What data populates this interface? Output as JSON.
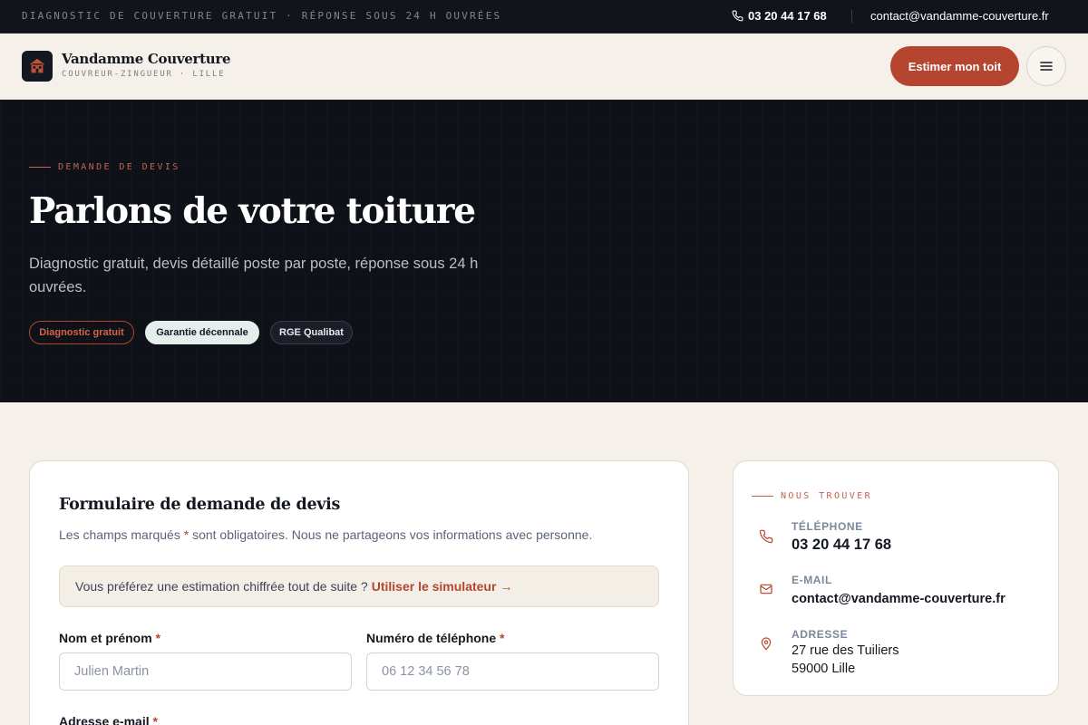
{
  "topbar": {
    "tagline": "DIAGNOSTIC DE COUVERTURE GRATUIT · RÉPONSE SOUS 24 H OUVRÉES",
    "phone": "03 20 44 17 68",
    "email": "contact@vandamme-couverture.fr",
    "phone_icon": "phone-icon"
  },
  "header": {
    "brand_name": "Vandamme Couverture",
    "brand_sub": "COUVREUR-ZINGUEUR · LILLE",
    "logo_icon": "house-roof-icon",
    "cta_label": "Estimer mon toit",
    "menu_icon": "hamburger-menu-icon"
  },
  "hero": {
    "eyebrow": "DEMANDE DE DEVIS",
    "title": "Parlons de votre toiture",
    "subtitle": "Diagnostic gratuit, devis détaillé poste par poste, réponse sous 24 h ouvrées.",
    "badges": [
      "Diagnostic gratuit",
      "Garantie décennale",
      "RGE Qualibat"
    ]
  },
  "form": {
    "title": "Formulaire de demande de devis",
    "note_before": "Les champs marqués ",
    "note_star": "*",
    "note_after": " sont obligatoires. Nous ne partageons vos informations avec personne.",
    "banner_text": "Vous préférez une estimation chiffrée tout de suite ?",
    "banner_link": "Utiliser le simulateur →",
    "fields": {
      "name_label": "Nom et prénom",
      "name_placeholder": "Julien Martin",
      "phone_label": "Numéro de téléphone",
      "phone_placeholder": "06 12 34 56 78",
      "email_label": "Adresse e-mail",
      "required_mark": "*"
    }
  },
  "contact": {
    "eyebrow": "NOUS TROUVER",
    "phone_label": "TÉLÉPHONE",
    "phone_value": "03 20 44 17 68",
    "email_label": "E-MAIL",
    "email_value": "contact@vandamme-couverture.fr",
    "address_label": "ADRESSE",
    "address_line1": "27 rue des Tuiliers",
    "address_line2": "59000 Lille"
  },
  "colors": {
    "accent": "#b5452e",
    "dark": "#0e1118",
    "cream": "#f5f1ea"
  }
}
